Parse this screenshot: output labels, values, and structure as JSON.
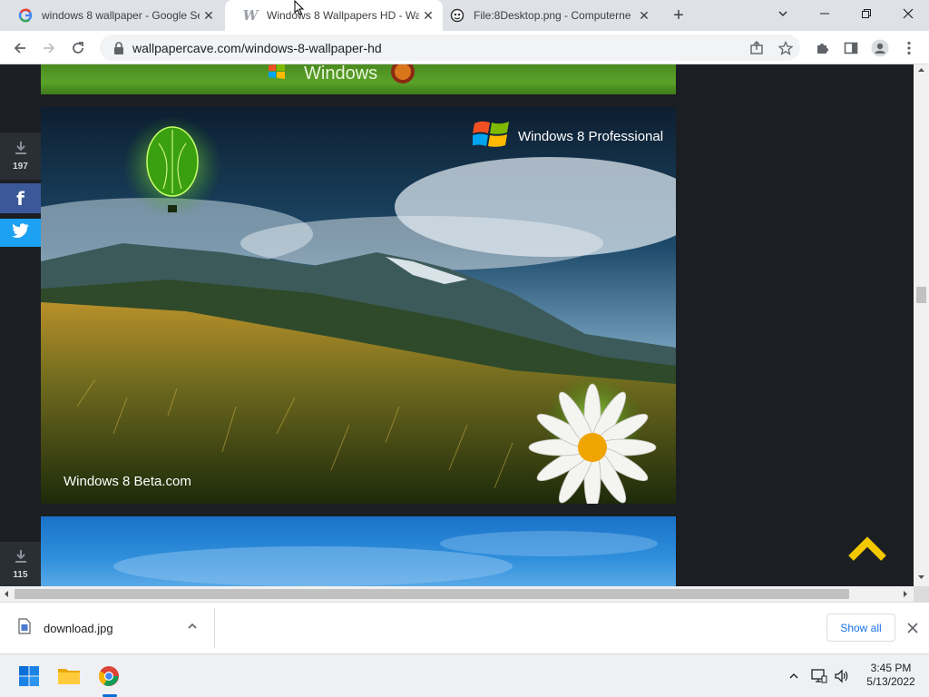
{
  "tabs": [
    {
      "title": "windows 8 wallpaper - Google Se",
      "icon": "google-icon"
    },
    {
      "title": "Windows 8 Wallpapers HD - Wal",
      "icon": "wallpapercave-icon"
    },
    {
      "title": "File:8Desktop.png - Computerne",
      "icon": "wiki-icon"
    }
  ],
  "toolbar": {
    "url": "wallpapercave.com/windows-8-wallpaper-hd"
  },
  "page": {
    "top_banner_text": "Windows",
    "wallpaper_brand": "Windows 8 Professional",
    "wallpaper_caption": "Windows 8 Beta.com",
    "download_count_1": "197",
    "download_count_2": "115"
  },
  "downloads": {
    "filename": "download.jpg",
    "show_all": "Show all"
  },
  "taskbar": {
    "time": "3:45 PM",
    "date": "5/13/2022"
  },
  "colors": {
    "accent_yellow": "#f3c800",
    "facebook": "#3b5998",
    "twitter": "#1da1f2",
    "page_bg": "#1b1e23"
  }
}
